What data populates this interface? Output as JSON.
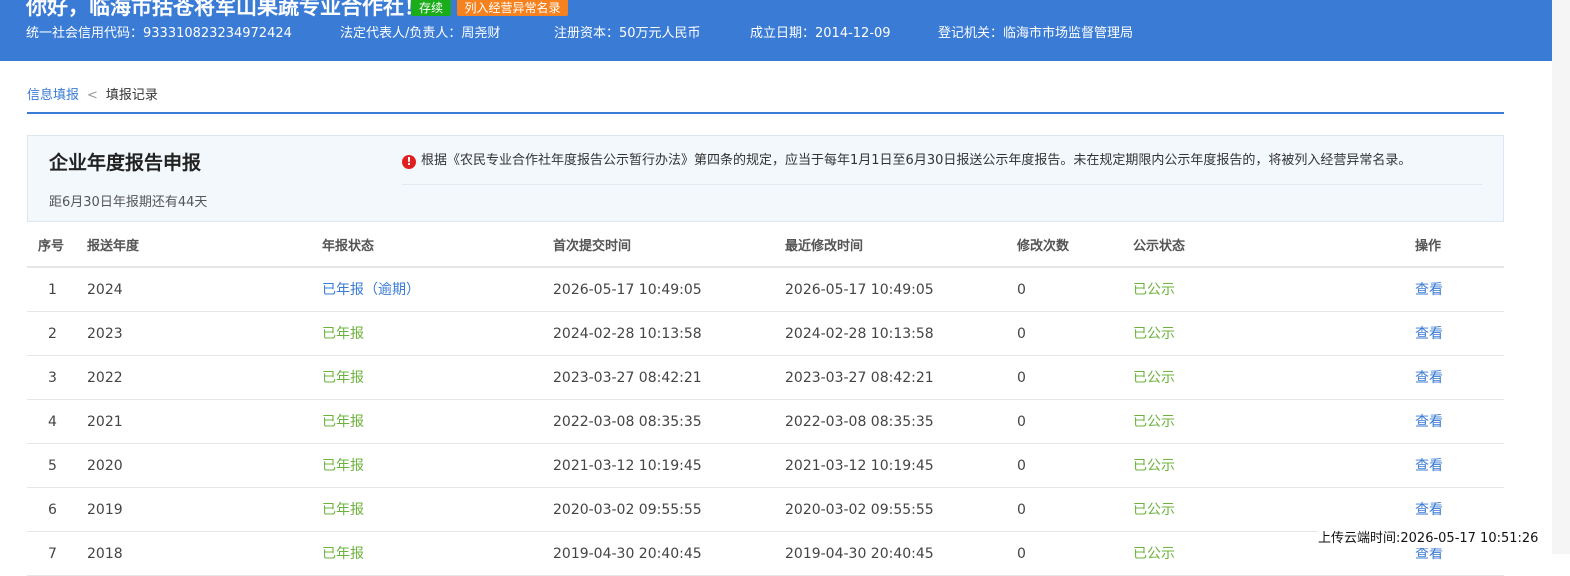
{
  "header": {
    "greeting": "你好，临海市括苍将军山果蔬专业合作社！",
    "badges": {
      "status": "存续",
      "abnormal": "列入经营异常名录"
    },
    "info": {
      "credit_code": "统一社会信用代码：933310823234972424",
      "legal_rep": "法定代表人/负责人：周尧财",
      "capital": "注册资本：50万元人民币",
      "founded": "成立日期：2014-12-09",
      "authority": "登记机关：临海市市场监督管理局"
    }
  },
  "breadcrumb": {
    "parent": "信息填报",
    "separator": "<",
    "current": "填报记录"
  },
  "notice": {
    "title": "企业年度报告申报",
    "alert": "根据《农民专业合作社年度报告公示暂行办法》第四条的规定，应当于每年1月1日至6月30日报送公示年度报告。未在规定期限内公示年度报告的，将被列入经营异常名录。",
    "countdown": "距6月30日年报期还有44天"
  },
  "table": {
    "headers": [
      "序号",
      "报送年度",
      "年报状态",
      "首次提交时间",
      "最近修改时间",
      "修改次数",
      "公示状态",
      "操作"
    ],
    "rows": [
      {
        "no": "1",
        "year": "2024",
        "status": "已年报（逾期）",
        "first": "2026-05-17 10:49:05",
        "last": "2026-05-17 10:49:05",
        "count": "0",
        "publish": "已公示",
        "action": "查看"
      },
      {
        "no": "2",
        "year": "2023",
        "status": "已年报",
        "first": "2024-02-28 10:13:58",
        "last": "2024-02-28 10:13:58",
        "count": "0",
        "publish": "已公示",
        "action": "查看"
      },
      {
        "no": "3",
        "year": "2022",
        "status": "已年报",
        "first": "2023-03-27 08:42:21",
        "last": "2023-03-27 08:42:21",
        "count": "0",
        "publish": "已公示",
        "action": "查看"
      },
      {
        "no": "4",
        "year": "2021",
        "status": "已年报",
        "first": "2022-03-08 08:35:35",
        "last": "2022-03-08 08:35:35",
        "count": "0",
        "publish": "已公示",
        "action": "查看"
      },
      {
        "no": "5",
        "year": "2020",
        "status": "已年报",
        "first": "2021-03-12 10:19:45",
        "last": "2021-03-12 10:19:45",
        "count": "0",
        "publish": "已公示",
        "action": "查看"
      },
      {
        "no": "6",
        "year": "2019",
        "status": "已年报",
        "first": "2020-03-02 09:55:55",
        "last": "2020-03-02 09:55:55",
        "count": "0",
        "publish": "已公示",
        "action": "查看"
      },
      {
        "no": "7",
        "year": "2018",
        "status": "已年报",
        "first": "2019-04-30 20:40:45",
        "last": "2019-04-30 20:40:45",
        "count": "0",
        "publish": "已公示",
        "action": "查看"
      }
    ]
  },
  "upload_time": "上传云端时间:2026-05-17 10:51:26",
  "colors": {
    "brand_blue": "#3a7bd5",
    "status_green": "#6cb33e",
    "badge_green": "#1aad19",
    "badge_orange": "#f5821f",
    "alert_red": "#e02020"
  }
}
